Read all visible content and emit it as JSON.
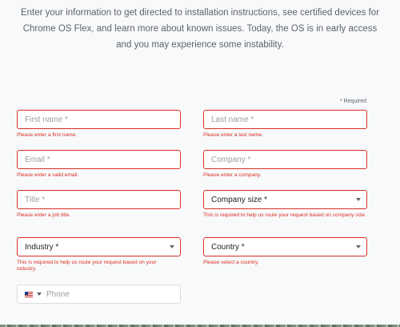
{
  "intro_text": "Enter your information to get directed to installation instructions, see certified devices for Chrome OS Flex, and learn more about known issues. Today, the OS is in early access and you may experience some instability.",
  "required_note": "* Required",
  "form": {
    "first_name": {
      "placeholder": "First name *",
      "error": "Please enter a first name."
    },
    "last_name": {
      "placeholder": "Last name *",
      "error": "Please enter a last name."
    },
    "email": {
      "placeholder": "Email *",
      "error": "Please enter a valid email."
    },
    "company": {
      "placeholder": "Company *",
      "error": "Please enter a company."
    },
    "title": {
      "placeholder": "Title *",
      "error": "Please enter a job title."
    },
    "company_size": {
      "label": "Company size *",
      "error": "This is required to help us route your request based on company size."
    },
    "industry": {
      "label": "Industry *",
      "error": "This is required to help us route your request based on your industry."
    },
    "country": {
      "label": "Country *",
      "error": "Please select a country."
    },
    "phone": {
      "placeholder": "Phone",
      "flag_icon": "us-flag-icon"
    }
  },
  "colors": {
    "error": "#d93025",
    "background": "#f8f9fa",
    "text": "#5f6368"
  }
}
